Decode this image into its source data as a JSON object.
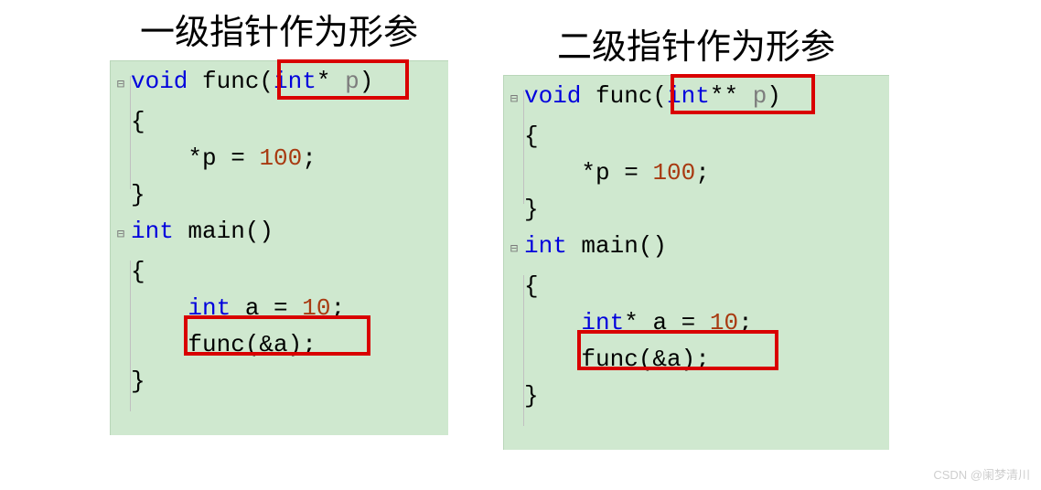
{
  "left": {
    "title": "一级指针作为形参",
    "code": {
      "l1": {
        "kw1": "void",
        "fn": " func(",
        "ty": "int",
        "star": "*",
        "sp": " ",
        "pn": "p",
        "cp": ")"
      },
      "l2": "{",
      "l3_pre": "    *p = ",
      "l3_num": "100",
      "l3_post": ";",
      "l4": "}",
      "l5": "",
      "l6": {
        "kw": "int",
        "rest": " main()"
      },
      "l7": "{",
      "l8": {
        "pre": "    ",
        "kw": "int",
        "mid": " a = ",
        "num": "10",
        "post": ";"
      },
      "l9": "    func(&a);",
      "l10": "}"
    }
  },
  "right": {
    "title": "二级指针作为形参",
    "code": {
      "l1": {
        "kw1": "void",
        "fn": " func(",
        "ty": "int",
        "star": "**",
        "sp": " ",
        "pn": "p",
        "cp": ")"
      },
      "l2": "{",
      "l3_pre": "    *p = ",
      "l3_num": "100",
      "l3_post": ";",
      "l4": "}",
      "l5": "",
      "l6": {
        "kw": "int",
        "rest": " main()"
      },
      "l7": "{",
      "l8": {
        "pre": "    ",
        "kw": "int",
        "star": "*",
        "mid": " a = ",
        "num": "10",
        "post": ";"
      },
      "l9": "    func(&a);",
      "l10": "}"
    }
  },
  "watermark": "CSDN @阑梦清川"
}
